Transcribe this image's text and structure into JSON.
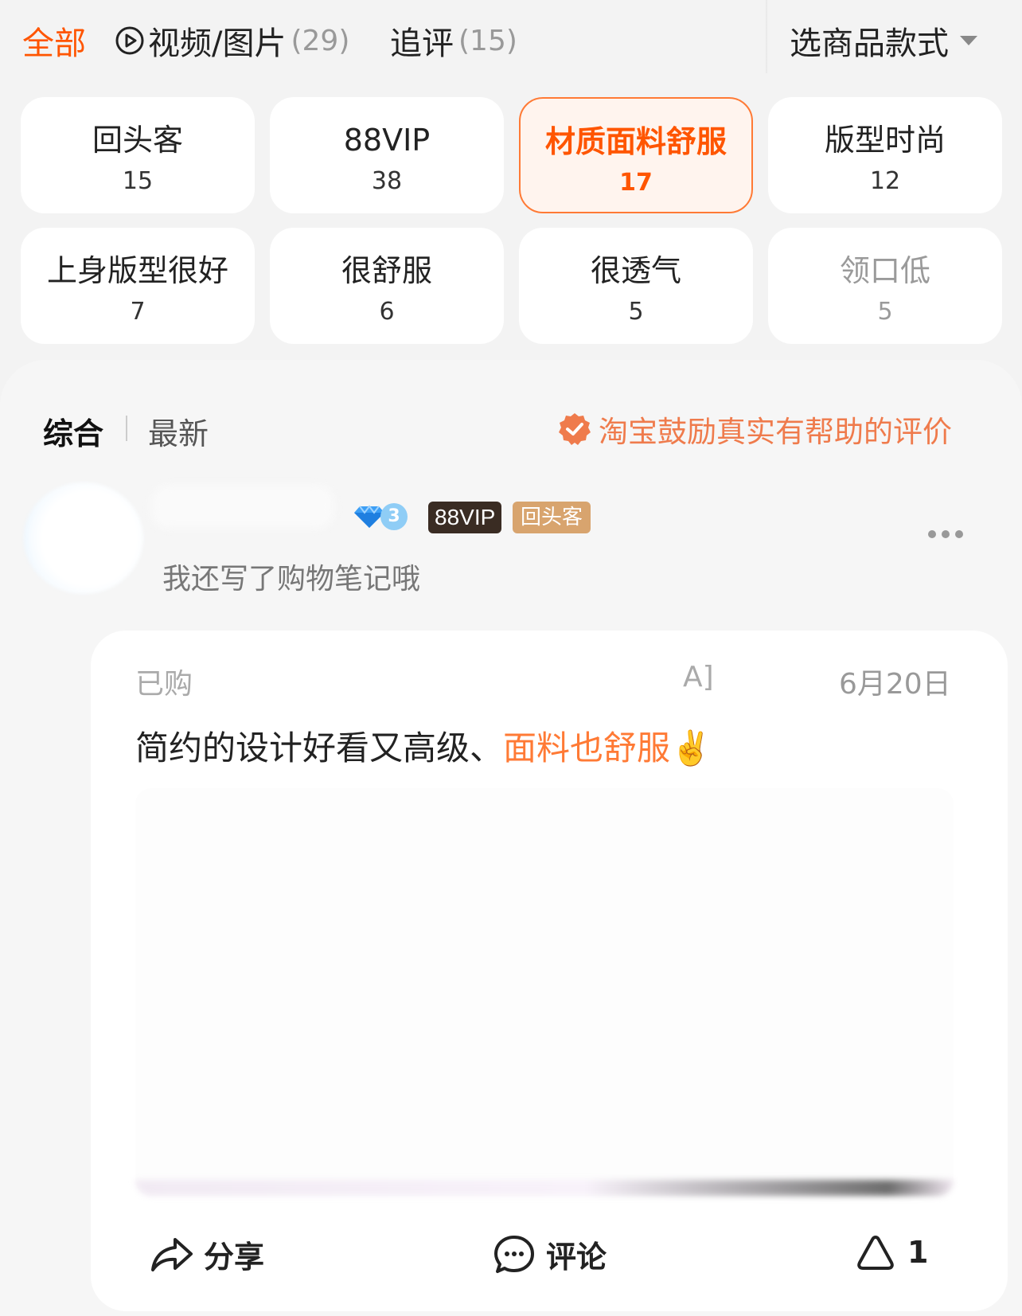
{
  "filters": {
    "all_label": "全部",
    "media_label": "视频/图片",
    "media_count": "(29)",
    "followup_label": "追评",
    "followup_count": "(15)",
    "style_select_label": "选商品款式"
  },
  "tags": [
    {
      "label": "回头客",
      "count": "15"
    },
    {
      "label": "88VIP",
      "count": "38"
    },
    {
      "label": "材质面料舒服",
      "count": "17"
    },
    {
      "label": "版型时尚",
      "count": "12"
    },
    {
      "label": "上身版型很好",
      "count": "7"
    },
    {
      "label": "很舒服",
      "count": "6"
    },
    {
      "label": "很透气",
      "count": "5"
    },
    {
      "label": "领口低",
      "count": "5"
    }
  ],
  "sort": {
    "comprehensive": "综合",
    "newest": "最新",
    "notice": "淘宝鼓励真实有帮助的评价"
  },
  "review": {
    "level": "3",
    "vip_badge": "88VIP",
    "return_badge": "回头客",
    "note": "我还写了购物笔记哦",
    "bought_prefix": "已购",
    "sku_tail": "A]",
    "date": "6月20日",
    "text_main": "简约的设计好看又高级、",
    "text_highlight": "面料也舒服",
    "text_emoji": "✌️",
    "share_label": "分享",
    "comment_label": "评论",
    "like_count": "1"
  },
  "colors": {
    "accent": "#ff5500",
    "highlight": "#ff7a35",
    "notice": "#ef7b4c",
    "background": "#f3f3f3"
  }
}
